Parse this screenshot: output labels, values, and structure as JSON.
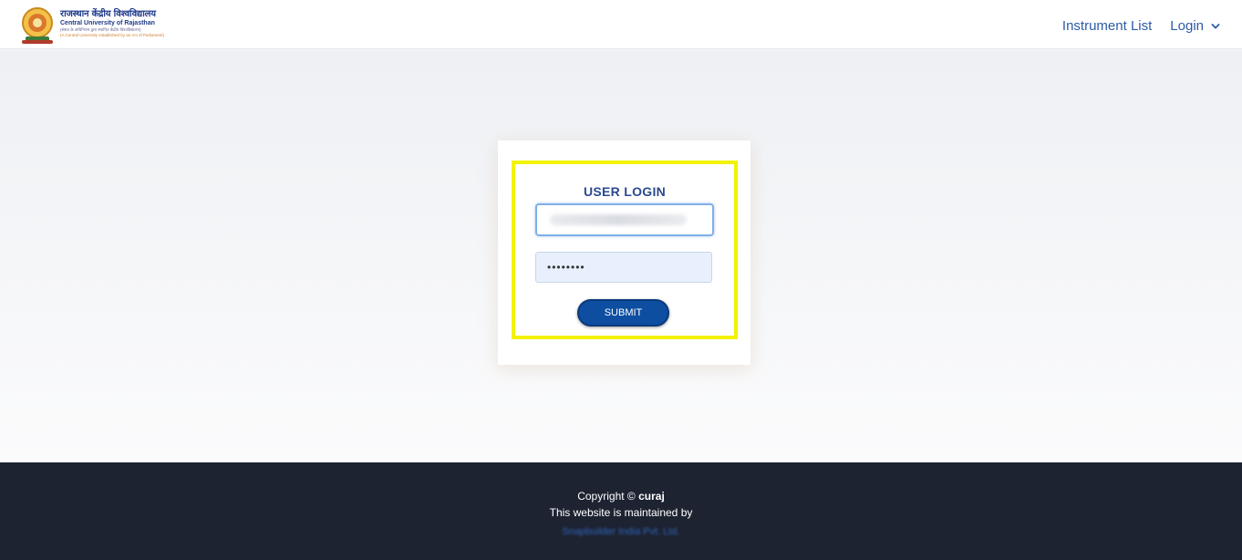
{
  "header": {
    "logo": {
      "hindi_name": "राजस्थान केंद्रीय विश्वविद्यालय",
      "english_name": "Central University of Rajasthan",
      "subline1": "(संसद के अधिनियम द्वारा स्थापित केंद्रीय विश्वविद्यालय)",
      "subline2": "(A Central University established by an Act of Parliament)"
    },
    "nav": {
      "instrument_list": "Instrument List",
      "login": "Login"
    }
  },
  "login_form": {
    "title": "USER LOGIN",
    "username_value": "",
    "password_value": "••••••••",
    "submit_label": "SUBMIT"
  },
  "footer": {
    "copyright_prefix": "Copyright © ",
    "copyright_brand": "curaj",
    "maintained_by": "This website is maintained by",
    "maintainer": "Snapbuilder India Pvt. Ltd."
  },
  "colors": {
    "accent": "#0d4ea1",
    "nav_link": "#2e5aa8",
    "highlight": "#f2f200",
    "footer_bg": "#1d2331"
  },
  "icons": {
    "logo_emblem": "university-emblem-icon",
    "login_dropdown": "chevron-down-icon"
  }
}
